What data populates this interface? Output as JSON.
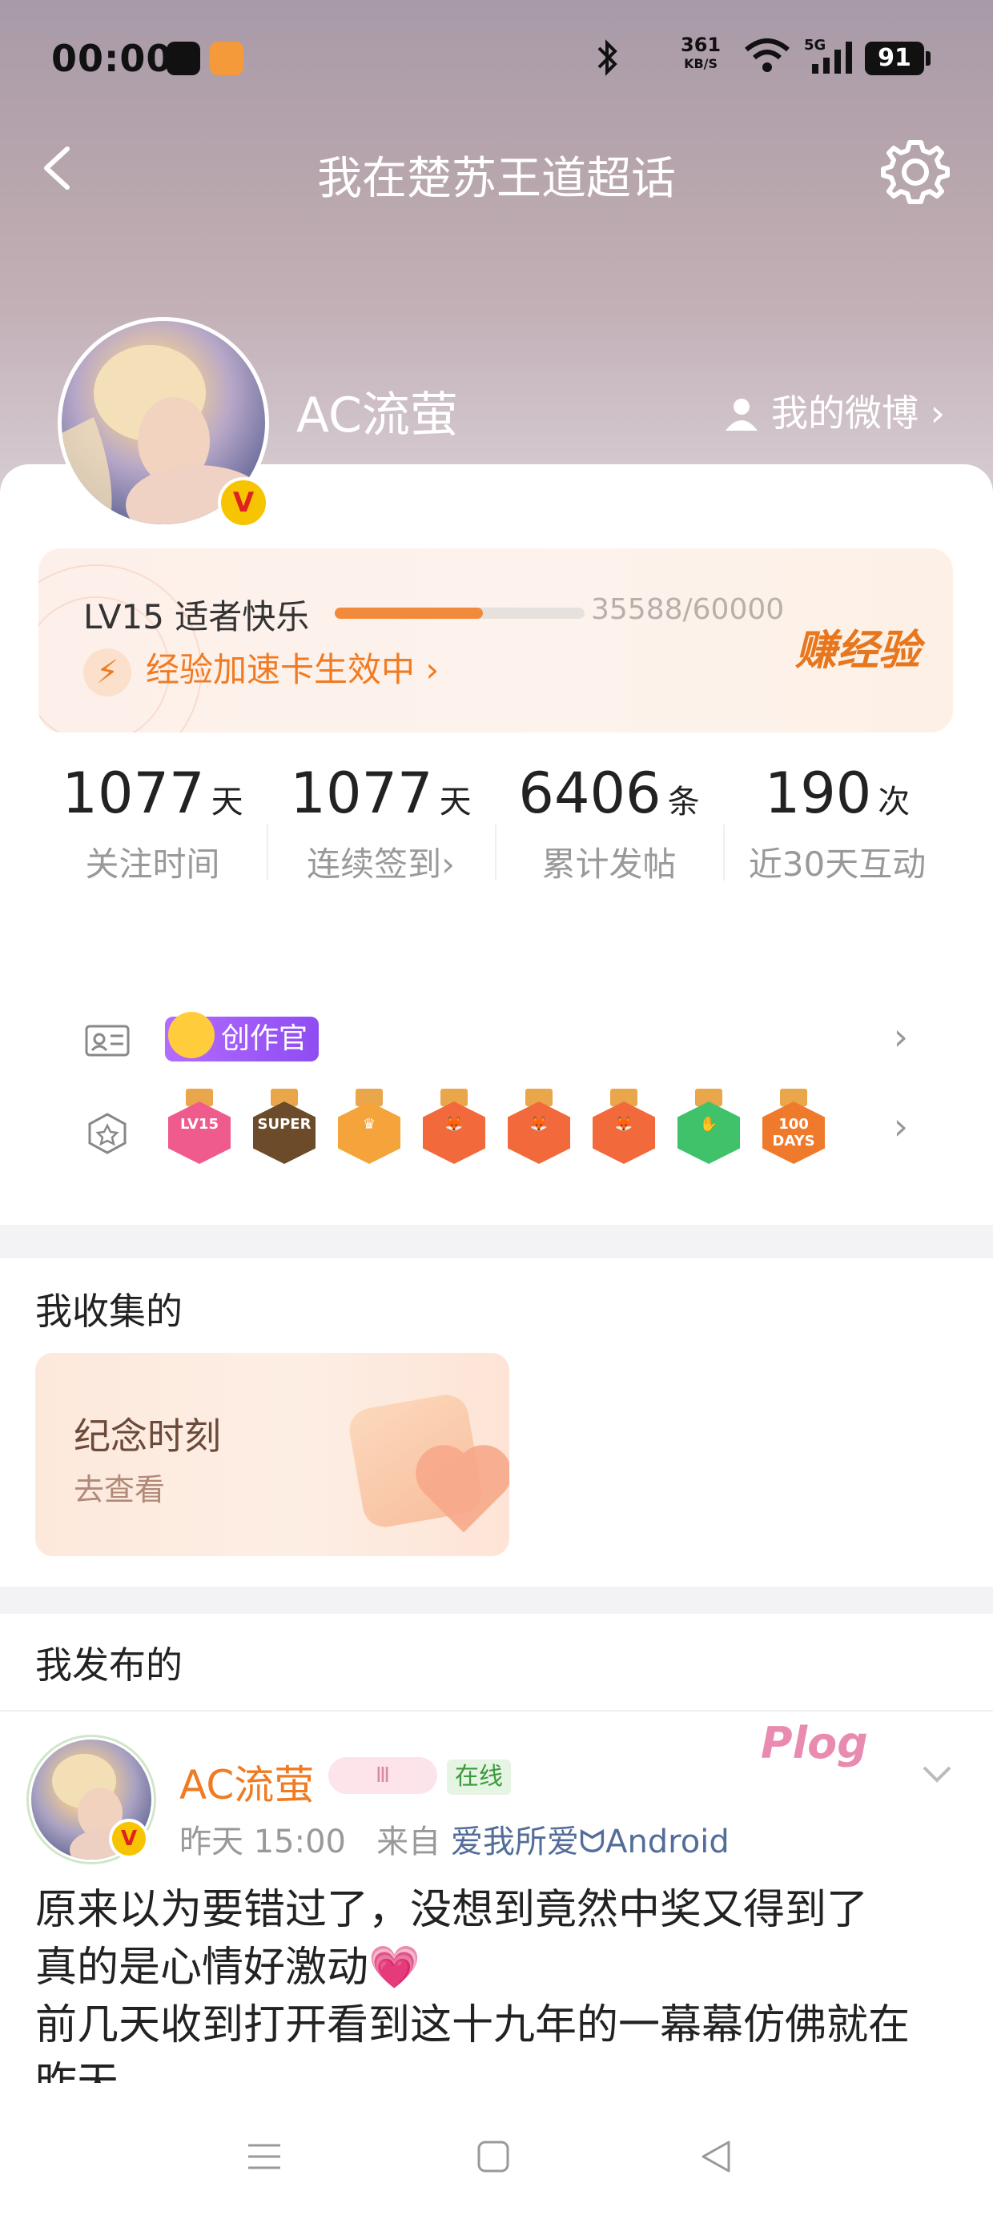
{
  "status_bar": {
    "time": "00:00",
    "speed_value": "361",
    "speed_unit": "KB/S",
    "network": "5G",
    "battery": "91"
  },
  "header": {
    "title": "我在楚苏王道超话",
    "username": "AC流萤",
    "my_weibo": "我的微博"
  },
  "level": {
    "label": "LV15 适者快乐",
    "progress_text": "35588/60000",
    "progress_value": 35588,
    "progress_max": 60000,
    "boost": "经验加速卡生效中",
    "earn": "赚经验"
  },
  "stats": [
    {
      "num": "1077",
      "unit": "天",
      "label": "关注时间"
    },
    {
      "num": "1077",
      "unit": "天",
      "label": "连续签到",
      "chevron": "›"
    },
    {
      "num": "6406",
      "unit": "条",
      "label": "累计发帖"
    },
    {
      "num": "190",
      "unit": "次",
      "label": "近30天互动"
    }
  ],
  "honors": {
    "creator_badge": "创作官",
    "medals": [
      {
        "name": "lv15-medal",
        "text": "LV15",
        "color": "#ef5b8c"
      },
      {
        "name": "super-medal",
        "text": "SUPER",
        "color": "#6b4b2a"
      },
      {
        "name": "crown-medal",
        "text": "♛",
        "color": "#f4a43a"
      },
      {
        "name": "fox-medal-1",
        "text": "🦊",
        "color": "#f26a3c"
      },
      {
        "name": "fox-medal-2",
        "text": "🦊",
        "color": "#f26a3c"
      },
      {
        "name": "fox-medal-3",
        "text": "🦊",
        "color": "#f26a3c"
      },
      {
        "name": "hand-medal",
        "text": "✋",
        "color": "#3fc26a"
      },
      {
        "name": "days-medal",
        "text": "100 DAYS",
        "color": "#f07a2c"
      }
    ]
  },
  "collected": {
    "heading": "我收集的",
    "card_title": "纪念时刻",
    "card_sub": "去查看"
  },
  "published": {
    "heading": "我发布的",
    "post": {
      "author": "AC流萤",
      "level_badge": "Ⅲ",
      "online": "在线",
      "plog": "Plog",
      "time": "昨天 15:00",
      "from_label": "来自",
      "source": "爱我所爱ᗢAndroid",
      "text_line1": "原来以为要错过了，没想到竟然中奖又得到了",
      "text_line2": "真的是心情好激动💗",
      "text_line3": "前几天收到打开看到这十九年的一幕幕仿佛就在",
      "text_line4": "昨天"
    }
  }
}
